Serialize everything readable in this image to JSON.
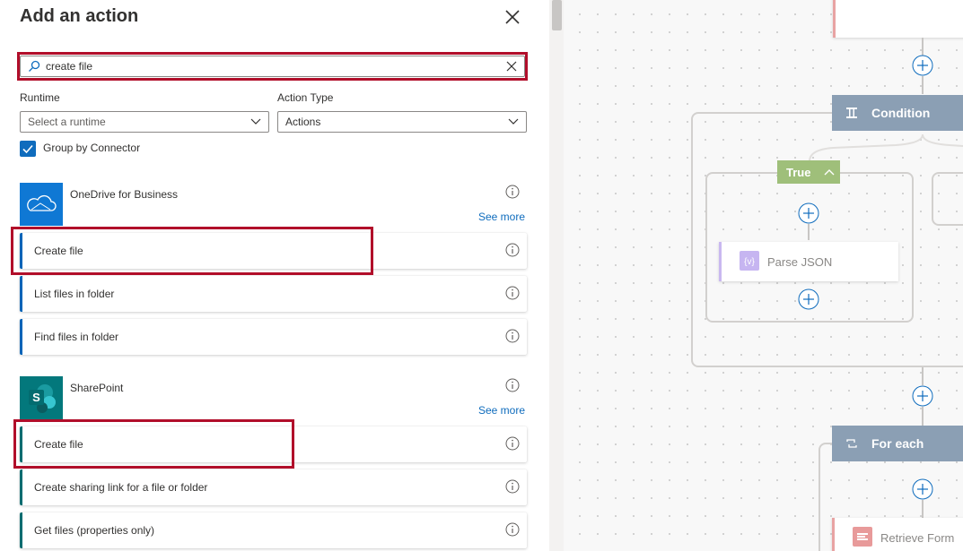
{
  "panel": {
    "title": "Add an action"
  },
  "search": {
    "value": "create file"
  },
  "filters": {
    "runtime_label": "Runtime",
    "runtime_placeholder": "Select a runtime",
    "action_type_label": "Action Type",
    "action_type_value": "Actions",
    "group_by_label": "Group by Connector",
    "group_by_checked": true
  },
  "connectors": [
    {
      "name": "OneDrive for Business",
      "see_more": "See more",
      "color": "#0364b8",
      "actions": [
        {
          "label": "Create file"
        },
        {
          "label": "List files in folder"
        },
        {
          "label": "Find files in folder"
        }
      ]
    },
    {
      "name": "SharePoint",
      "see_more": "See more",
      "color": "#036c70",
      "actions": [
        {
          "label": "Create file"
        },
        {
          "label": "Create sharing link for a file or folder"
        },
        {
          "label": "Get files (properties only)"
        }
      ]
    }
  ],
  "flow": {
    "condition_label": "Condition",
    "true_label": "True",
    "parse_json_label": "Parse JSON",
    "for_each_label": "For each",
    "retrieve_label": "Retrieve Form"
  },
  "colors": {
    "highlight": "#b10e2a",
    "link": "#0f6cbd",
    "condition_header": "#8b9fb4",
    "true_badge": "#9fbf7a"
  }
}
